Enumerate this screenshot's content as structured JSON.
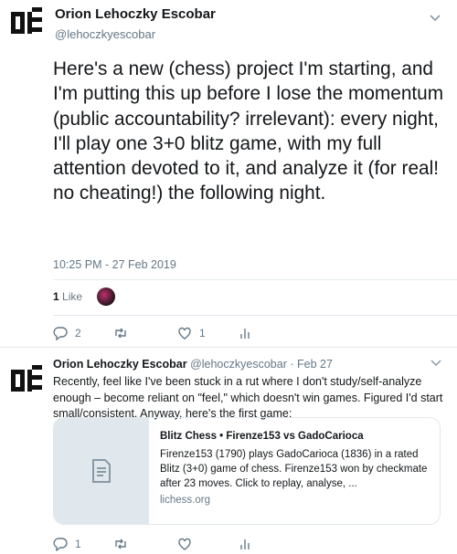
{
  "tweet": {
    "author_name": "Orion Lehoczky Escobar",
    "author_handle": "@lehoczkyescobar",
    "text": "Here's a new (chess) project I'm starting, and I'm putting this up before I lose the momentum (public accountability? irrelevant): every night, I'll play one 3+0 blitz game, with my full attention devoted to it, and analyze it (for real! no cheating!) the following night.",
    "timestamp": "10:25 PM - 27 Feb 2019",
    "likes_count": "1",
    "likes_label": "Like",
    "reply_count": "2",
    "retweet_count": "",
    "like_action_count": "1"
  },
  "reply": {
    "author_name": "Orion Lehoczky Escobar",
    "author_handle": "@lehoczkyescobar",
    "date": "Feb 27",
    "text": "Recently, feel like I've been stuck in a rut where I don't study/self-analyze enough – become reliant on \"feel,\" which doesn't win games. Figured I'd start small/consistent. Anyway, here's the first game:",
    "card": {
      "title": "Blitz Chess • Firenze153 vs GadoCarioca",
      "description": "Firenze153 (1790) plays GadoCarioca (1836) in a rated Blitz (3+0) game of chess. Firenze153 won by checkmate after 23 moves. Click to replay, analyse, ...",
      "domain": "lichess.org"
    },
    "reply_count": "1",
    "retweet_count": "",
    "like_count": ""
  },
  "colors": {
    "text": "#14171a",
    "secondary": "#657786",
    "border": "#e6ecf0"
  }
}
